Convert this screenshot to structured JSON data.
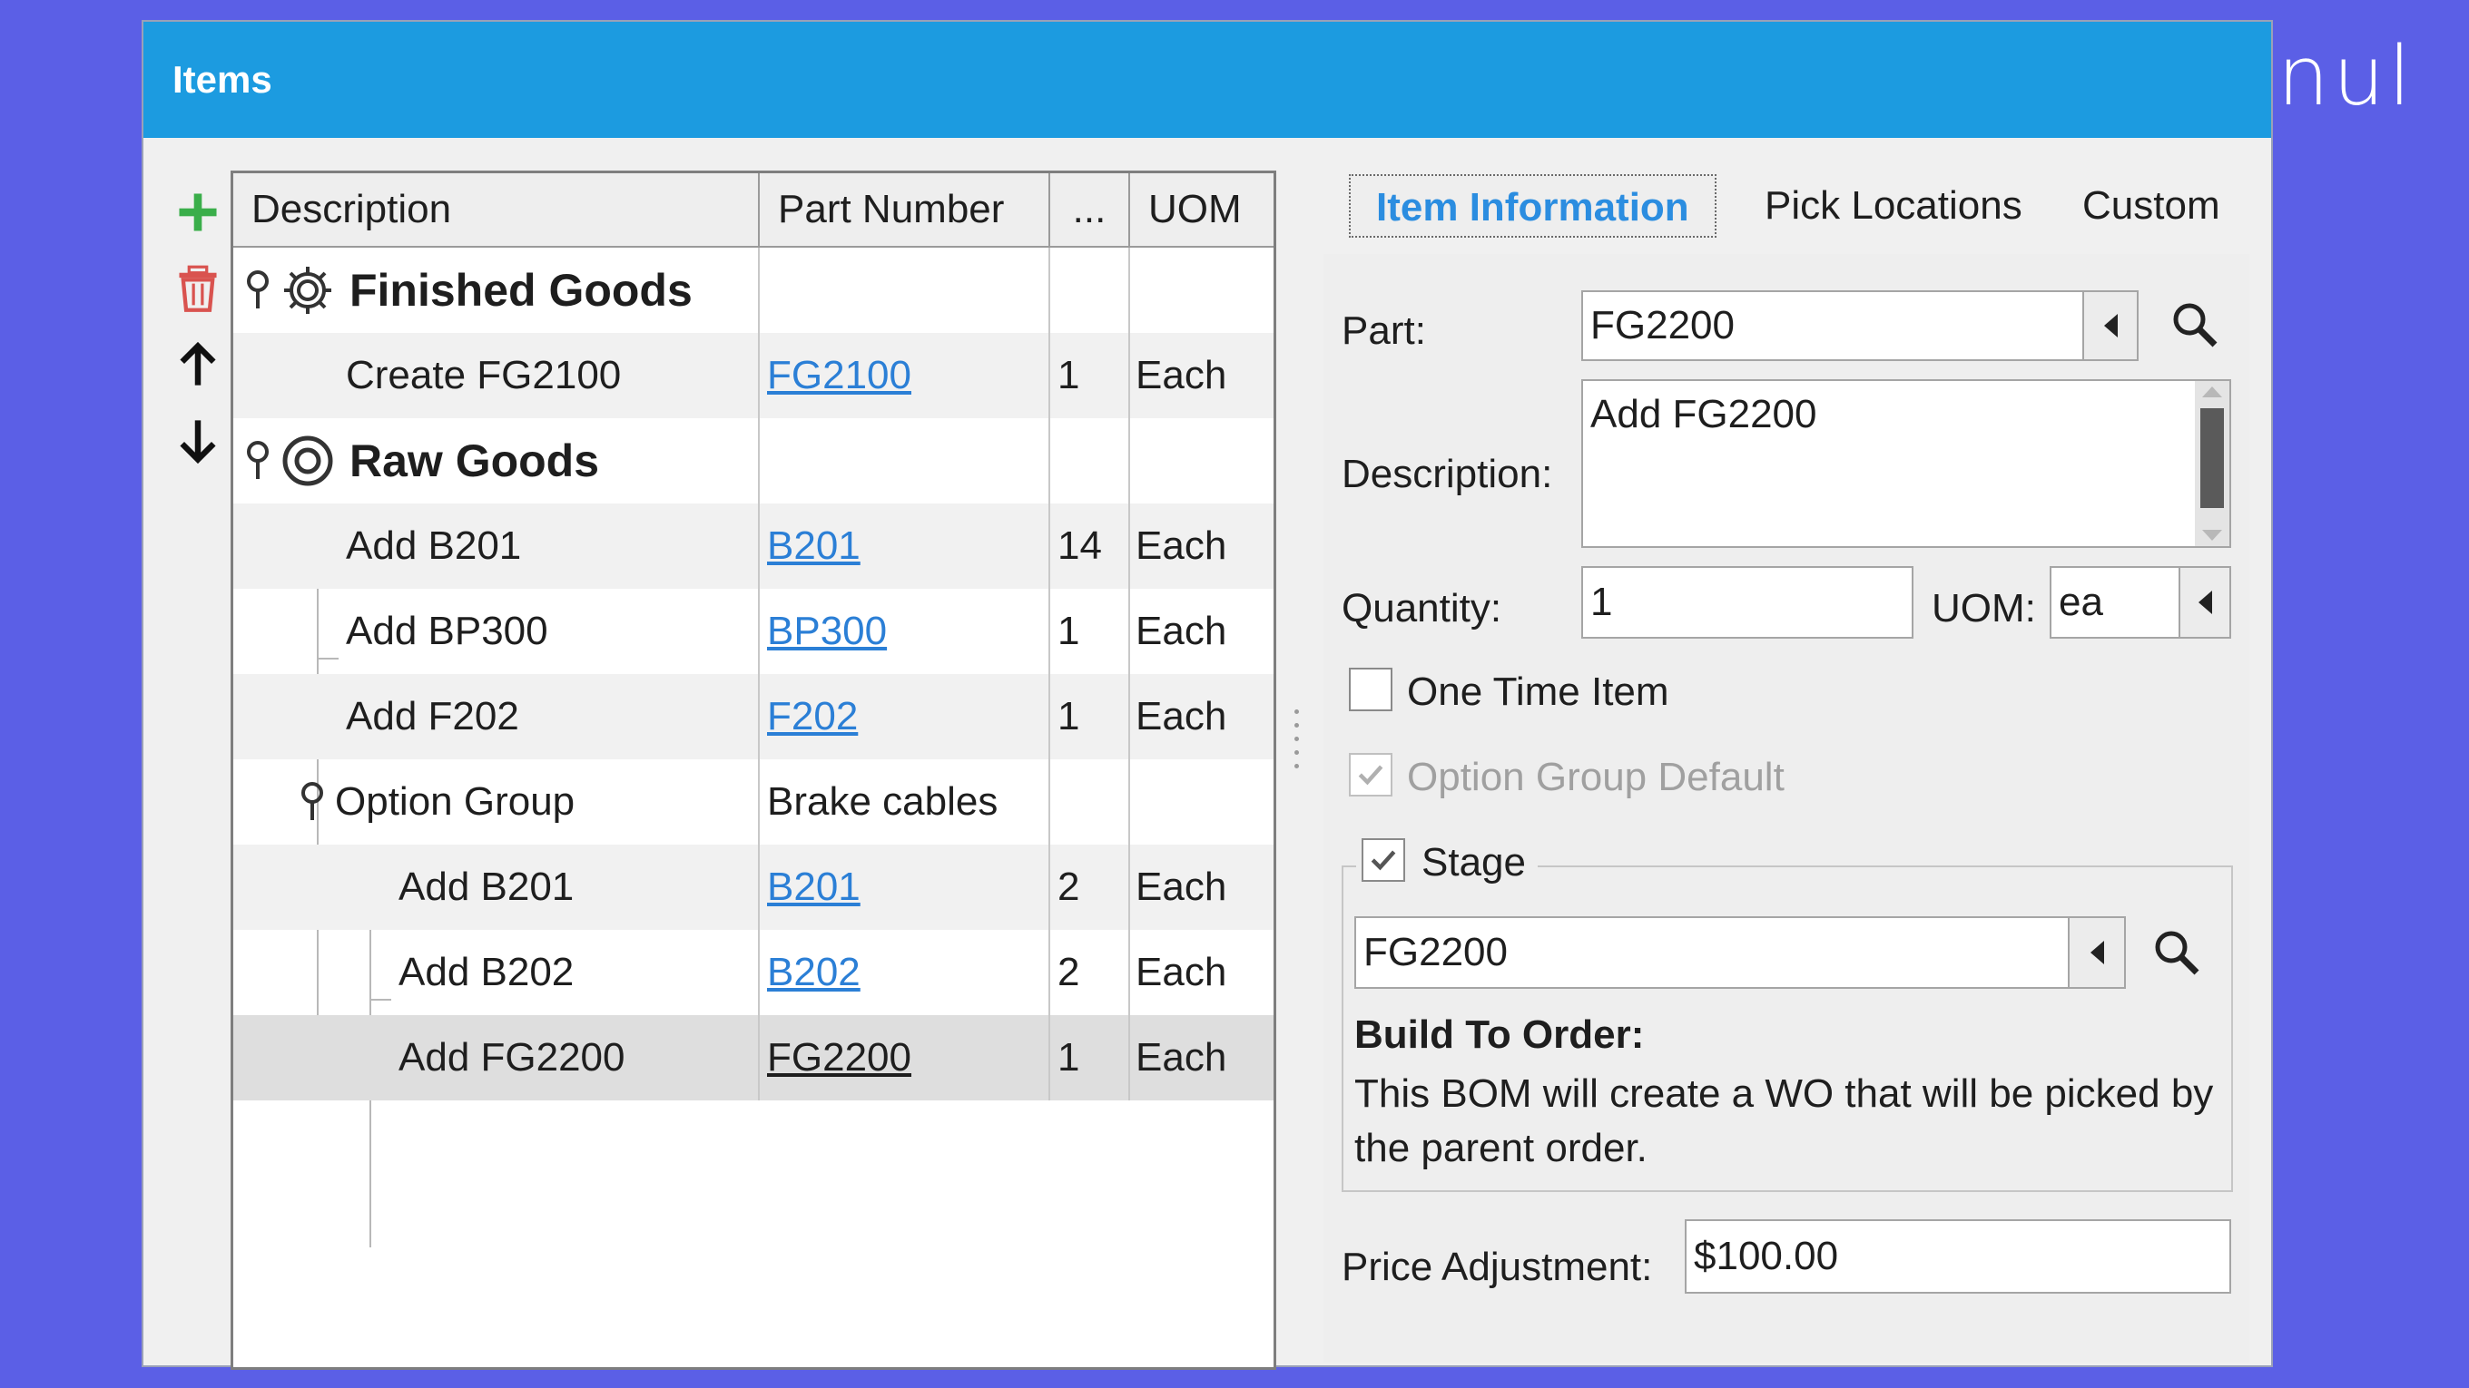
{
  "brand": "nul",
  "window": {
    "title": "Items"
  },
  "toolbar": {
    "add_icon": "plus-icon",
    "delete_icon": "trash-icon",
    "up_icon": "arrow-up-icon",
    "down_icon": "arrow-down-icon",
    "colors": {
      "add": "#3aae4a",
      "delete": "#d9534f"
    }
  },
  "grid": {
    "columns": [
      "Description",
      "Part Number",
      "...",
      "UOM"
    ],
    "rows": [
      {
        "desc": "Finished Goods",
        "part": "",
        "qty": "",
        "uom": "",
        "type": "group"
      },
      {
        "desc": "Create FG2100",
        "part": "FG2100",
        "qty": "1",
        "uom": "Each",
        "type": "item"
      },
      {
        "desc": "Raw Goods",
        "part": "",
        "qty": "",
        "uom": "",
        "type": "group"
      },
      {
        "desc": "Add B201",
        "part": "B201",
        "qty": "14",
        "uom": "Each",
        "type": "item"
      },
      {
        "desc": "Add BP300",
        "part": "BP300",
        "qty": "1",
        "uom": "Each",
        "type": "item"
      },
      {
        "desc": "Add F202",
        "part": "F202",
        "qty": "1",
        "uom": "Each",
        "type": "item"
      },
      {
        "desc": "Option Group",
        "part": "Brake cables",
        "qty": "",
        "uom": "",
        "type": "option"
      },
      {
        "desc": "Add B201",
        "part": "B201",
        "qty": "2",
        "uom": "Each",
        "type": "item"
      },
      {
        "desc": "Add B202",
        "part": "B202",
        "qty": "2",
        "uom": "Each",
        "type": "item"
      },
      {
        "desc": "Add FG2200",
        "part": "FG2200",
        "qty": "1",
        "uom": "Each",
        "type": "item",
        "selected": true
      }
    ]
  },
  "tabs": [
    "Item Information",
    "Pick Locations",
    "Custom"
  ],
  "form": {
    "part_label": "Part:",
    "part_value": "FG2200",
    "description_label": "Description:",
    "description_value": "Add FG2200",
    "quantity_label": "Quantity:",
    "quantity_value": "1",
    "uom_label": "UOM:",
    "uom_value": "ea",
    "one_time_label": "One Time Item",
    "one_time_checked": false,
    "option_default_label": "Option Group Default",
    "option_default_checked": true,
    "stage_label": "Stage",
    "stage_checked": true,
    "stage_value": "FG2200",
    "build_title": "Build To Order:",
    "build_text": "This BOM will create a WO that will be picked by the parent order.",
    "price_label": "Price Adjustment:",
    "price_value": "$100.00"
  },
  "colors": {
    "titlebar": "#1c9be0",
    "background": "#5b5fe6",
    "link": "#2b7fd6",
    "active_tab": "#2b8de0"
  }
}
